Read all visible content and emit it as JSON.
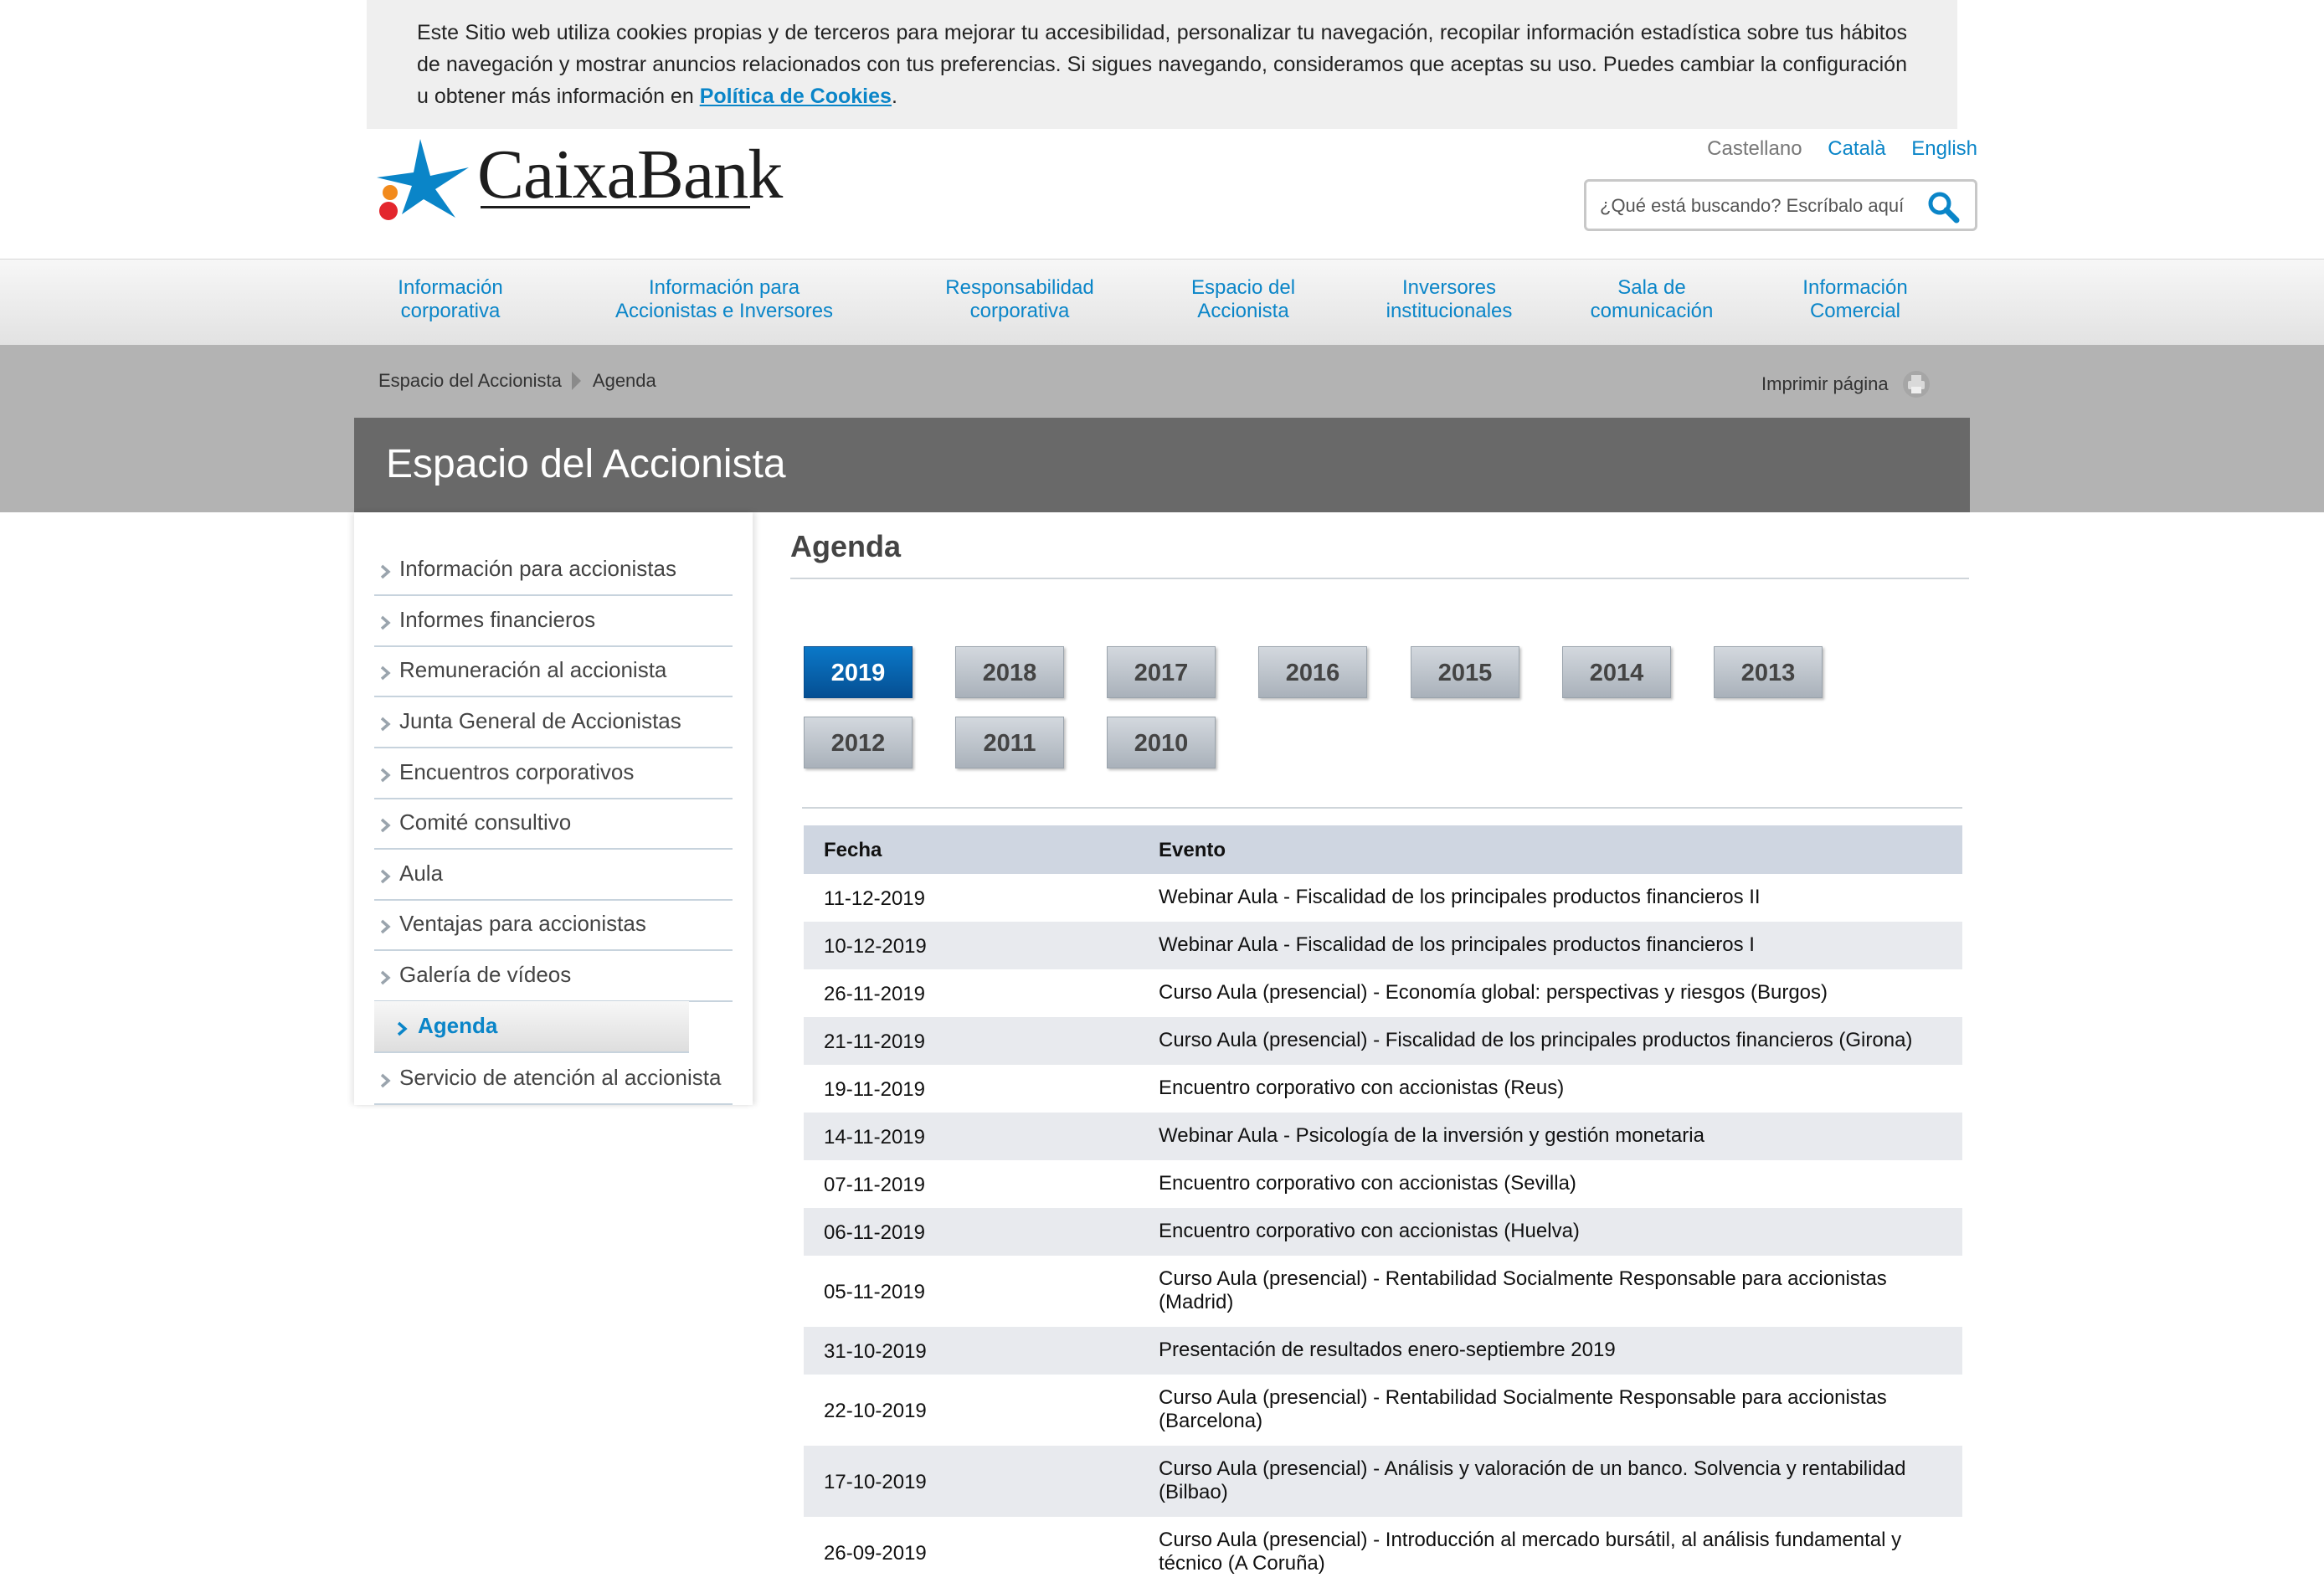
{
  "cookie": {
    "text": "Este Sitio web utiliza cookies propias y de terceros para mejorar tu accesibilidad, personalizar tu navegación, recopilar información estadística sobre tus hábitos de navegación y mostrar anuncios relacionados con tus preferencias. Si sigues navegando, consideramos que aceptas su uso. Puedes cambiar la configuración u obtener más información en ",
    "link": "Política de Cookies",
    "end": "."
  },
  "brand": {
    "name": "CaixaBank",
    "accent": "#0a85c8",
    "logo_orange": "#f28a1c",
    "logo_red": "#e3262d"
  },
  "languages": {
    "active": "Castellano",
    "ca": "Català",
    "en": "English"
  },
  "search": {
    "placeholder": "¿Qué está buscando? Escríbalo aquí",
    "icon": "search-icon"
  },
  "nav": [
    {
      "l1": "Información",
      "l2": "corporativa"
    },
    {
      "l1": "Información para",
      "l2": "Accionistas e Inversores"
    },
    {
      "l1": "Responsabilidad",
      "l2": "corporativa"
    },
    {
      "l1": "Espacio del",
      "l2": "Accionista"
    },
    {
      "l1": "Inversores",
      "l2": "institucionales"
    },
    {
      "l1": "Sala de",
      "l2": "comunicación"
    },
    {
      "l1": "Información",
      "l2": "Comercial"
    }
  ],
  "breadcrumb": {
    "parent": "Espacio del Accionista",
    "current": "Agenda"
  },
  "print_label": "Imprimir página",
  "section_title": "Espacio del Accionista",
  "sidebar": [
    "Información para accionistas",
    "Informes financieros",
    "Remuneración al accionista",
    "Junta General de Accionistas",
    "Encuentros corporativos",
    "Comité consultivo",
    "Aula",
    "Ventajas para accionistas",
    "Galería de vídeos",
    "Agenda",
    "Servicio de atención al accionista"
  ],
  "sidebar_active": "Agenda",
  "main_title": "Agenda",
  "years": [
    "2019",
    "2018",
    "2017",
    "2016",
    "2015",
    "2014",
    "2013",
    "2012",
    "2011",
    "2010"
  ],
  "year_active": "2019",
  "table": {
    "headers": {
      "date": "Fecha",
      "event": "Evento"
    },
    "rows": [
      {
        "date": "11-12-2019",
        "event": "Webinar Aula - Fiscalidad de los principales productos financieros II"
      },
      {
        "date": "10-12-2019",
        "event": "Webinar Aula - Fiscalidad de los principales productos financieros I"
      },
      {
        "date": "26-11-2019",
        "event": "Curso Aula (presencial) - Economía global: perspectivas y riesgos (Burgos)"
      },
      {
        "date": "21-11-2019",
        "event": "Curso Aula (presencial) - Fiscalidad de los principales productos financieros (Girona)"
      },
      {
        "date": "19-11-2019",
        "event": "Encuentro corporativo con accionistas (Reus)"
      },
      {
        "date": "14-11-2019",
        "event": "Webinar Aula - Psicología de la inversión y gestión monetaria"
      },
      {
        "date": "07-11-2019",
        "event": "Encuentro corporativo con accionistas (Sevilla)"
      },
      {
        "date": "06-11-2019",
        "event": "Encuentro corporativo con accionistas (Huelva)"
      },
      {
        "date": "05-11-2019",
        "event": "Curso Aula (presencial) - Rentabilidad Socialmente Responsable para accionistas (Madrid)"
      },
      {
        "date": "31-10-2019",
        "event": "Presentación de resultados enero-septiembre 2019"
      },
      {
        "date": "22-10-2019",
        "event": "Curso Aula (presencial) - Rentabilidad Socialmente Responsable para accionistas (Barcelona)"
      },
      {
        "date": "17-10-2019",
        "event": "Curso Aula (presencial) - Análisis y valoración de un banco. Solvencia y rentabilidad (Bilbao)"
      },
      {
        "date": "26-09-2019",
        "event": "Curso Aula (presencial) - Introducción al mercado bursátil, al análisis fundamental y técnico (A Coruña)"
      }
    ]
  }
}
